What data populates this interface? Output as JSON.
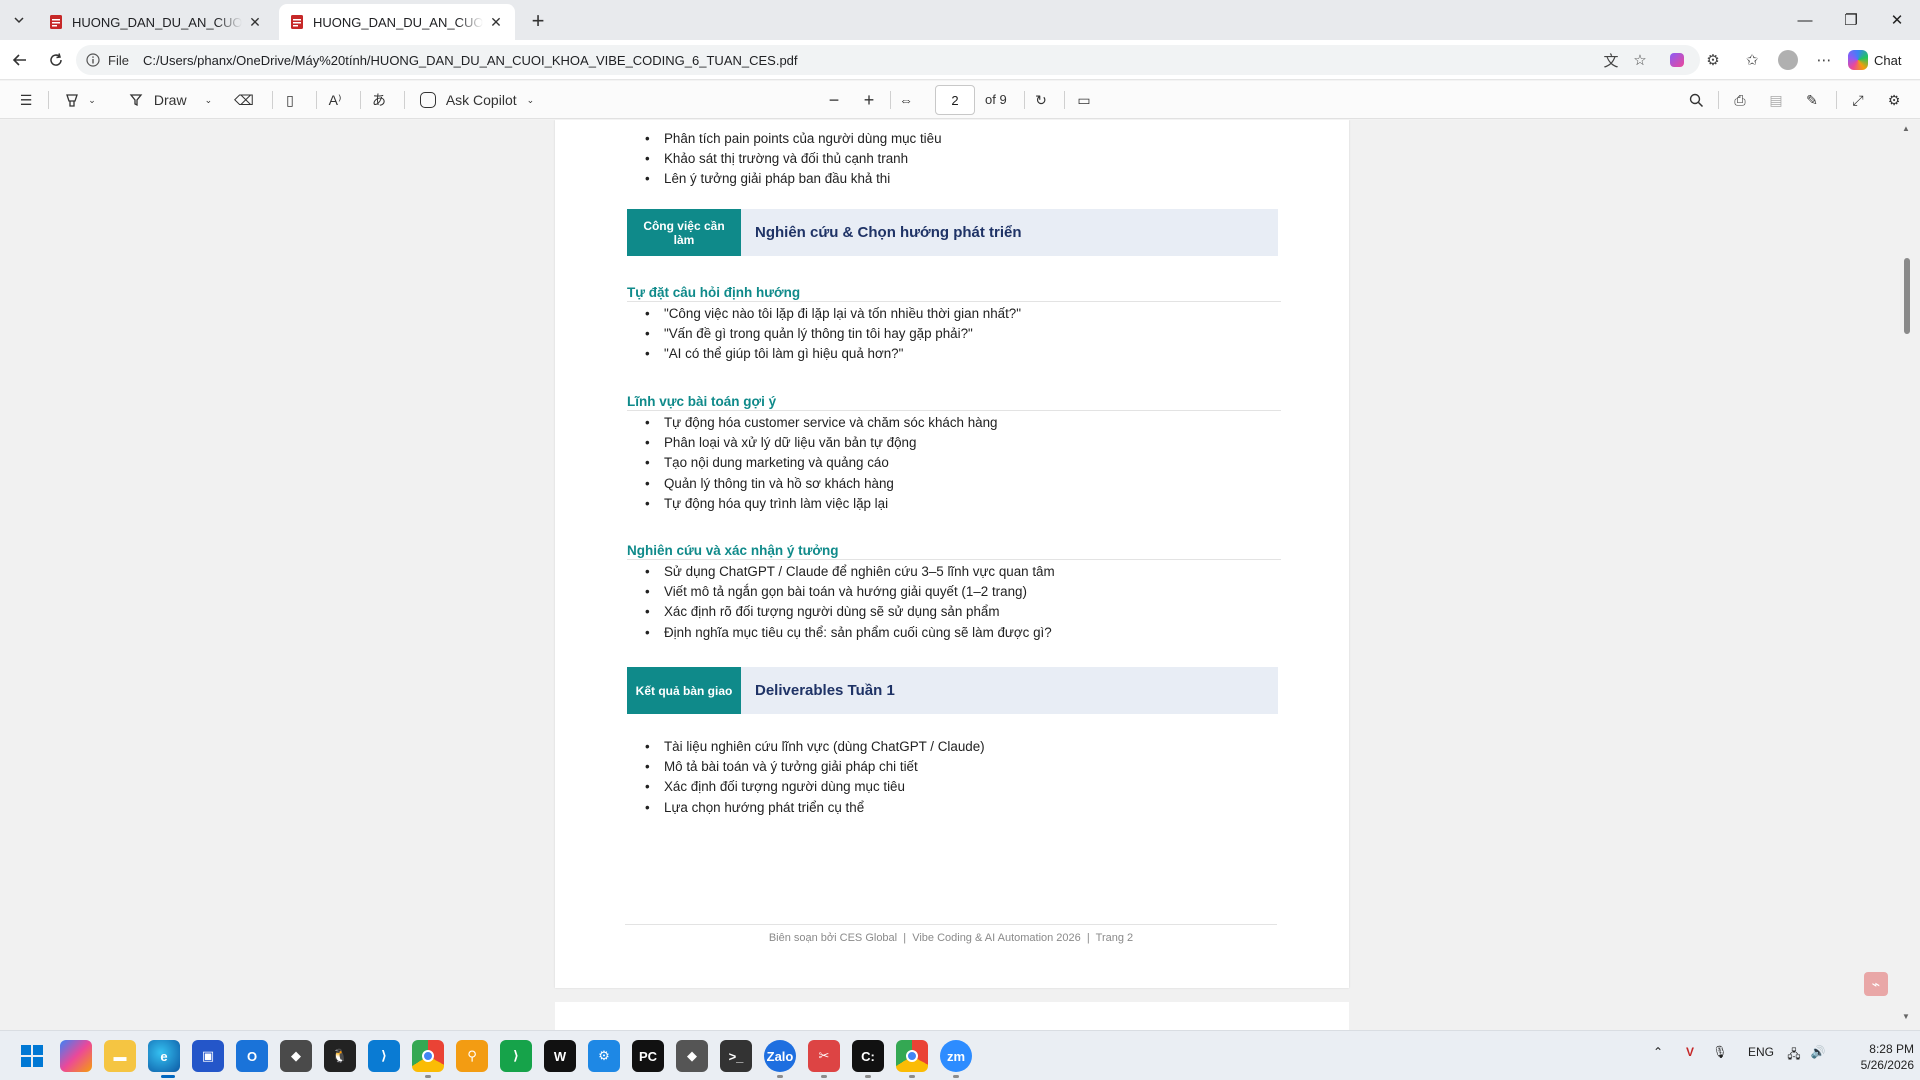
{
  "browser": {
    "tabs": [
      {
        "title": "HUONG_DAN_DU_AN_CUOI_KHOA_VIBE_CODING_6_TUAN_CES.pdf",
        "active": false
      },
      {
        "title": "HUONG_DAN_DU_AN_CUOI_KHOA_VIBE_CODING_6_TUAN_CES.pdf",
        "active": true
      }
    ],
    "address": {
      "scheme_label": "File",
      "url": "C:/Users/phanx/OneDrive/Máy%20tính/HUONG_DAN_DU_AN_CUOI_KHOA_VIBE_CODING_6_TUAN_CES.pdf"
    },
    "chat_label": "Chat"
  },
  "pdf_toolbar": {
    "draw_label": "Draw",
    "ask_copilot_label": "Ask Copilot",
    "page_number": "2",
    "page_total": "of 9"
  },
  "document": {
    "top_bullets": [
      "Phân tích pain points của người dùng mục tiêu",
      "Khảo sát thị trường và đối thủ cạnh tranh",
      "Lên ý tưởng giải pháp ban đầu khả thi"
    ],
    "section1": {
      "tag": "Công việc cần làm",
      "title": "Nghiên cứu & Chọn hướng phát triển"
    },
    "subsections": [
      {
        "heading": "Tự đặt câu hỏi định hướng",
        "items": [
          "\"Công việc nào tôi lặp đi lặp lại và tốn nhiều thời gian nhất?\"",
          "\"Vấn đề gì trong quản lý thông tin tôi hay gặp phải?\"",
          "\"AI có thể giúp tôi làm gì hiệu quả hơn?\""
        ]
      },
      {
        "heading": "Lĩnh vực bài toán gợi ý",
        "items": [
          "Tự động hóa customer service và chăm sóc khách hàng",
          "Phân loại và xử lý dữ liệu văn bản tự động",
          "Tạo nội dung marketing và quảng cáo",
          "Quản lý thông tin và hồ sơ khách hàng",
          "Tự động hóa quy trình làm việc lặp lại"
        ]
      },
      {
        "heading": "Nghiên cứu và xác nhận ý tưởng",
        "items": [
          "Sử dụng ChatGPT / Claude để nghiên cứu 3–5 lĩnh vực quan tâm",
          "Viết mô tả ngắn gọn bài toán và hướng giải quyết (1–2 trang)",
          "Xác định rõ đối tượng người dùng sẽ sử dụng sản phẩm",
          "Định nghĩa mục tiêu cụ thể: sản phẩm cuối cùng sẽ làm được gì?"
        ]
      }
    ],
    "section2": {
      "tag": "Kết quả bàn giao",
      "title": "Deliverables Tuần 1"
    },
    "deliverables": [
      "Tài liệu nghiên cứu lĩnh vực (dùng ChatGPT / Claude)",
      "Mô tả bài toán và ý tưởng giải pháp chi tiết",
      "Xác định đối tượng người dùng mục tiêu",
      "Lựa chọn hướng phát triển cụ thể"
    ],
    "footer": "Biên soạn bởi CES Global  |  Vibe Coding & AI Automation 2026  |  Trang 2"
  },
  "taskbar": {
    "lang": "ENG",
    "time": "8:28 PM",
    "date": "5/26/2026"
  },
  "colors": {
    "accent_teal": "#0f8a8a",
    "section_bg": "#e8edf5",
    "section_title": "#1f3366"
  }
}
